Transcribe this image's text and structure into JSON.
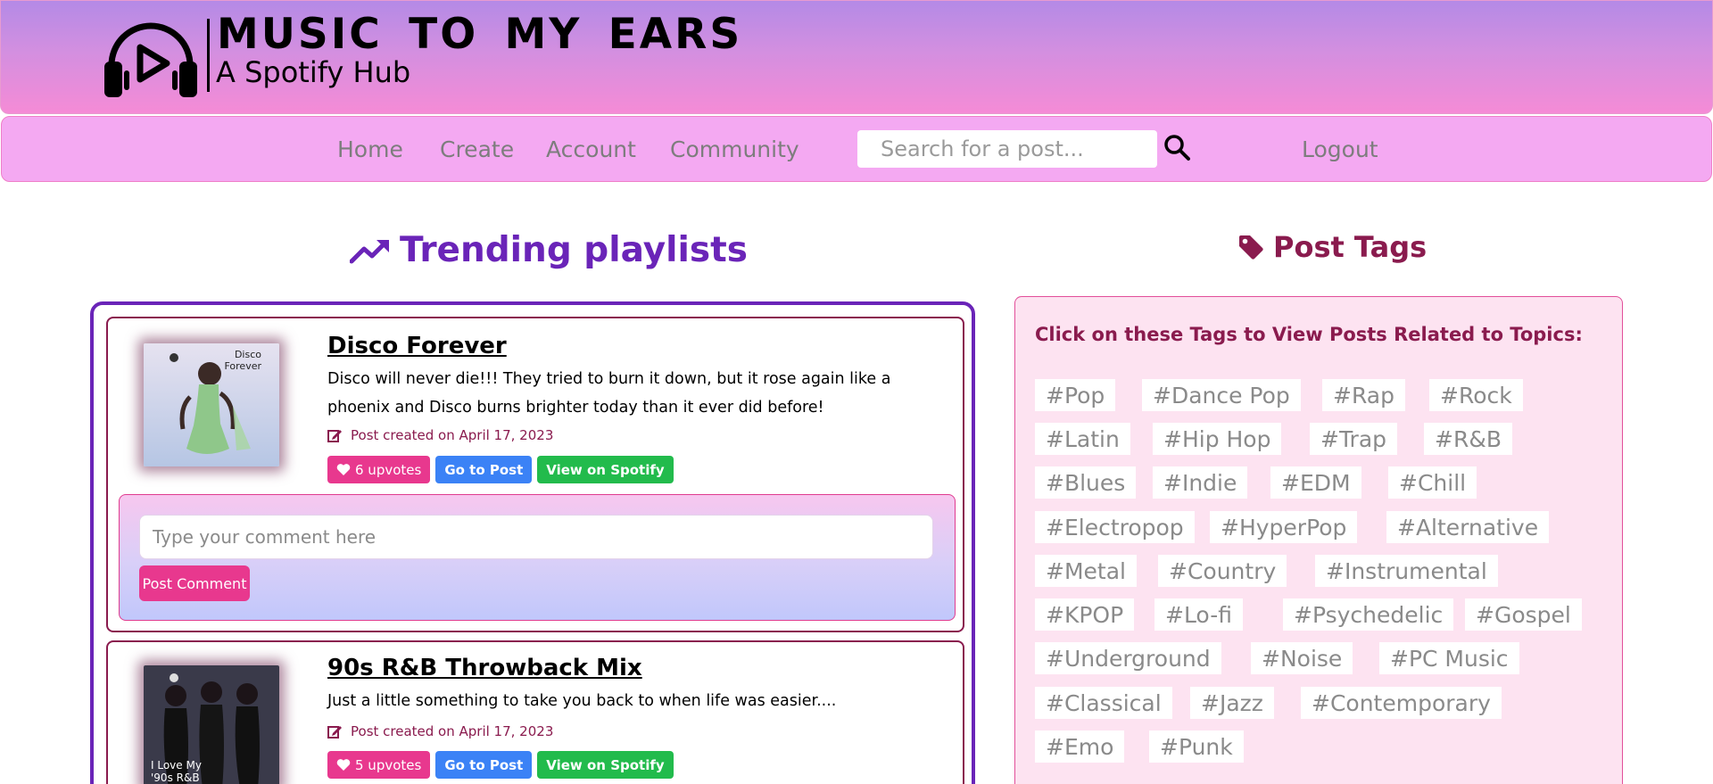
{
  "header": {
    "title": "MUSIC TO MY EARS",
    "subtitle": "A Spotify Hub",
    "icon": "headphones-play-icon"
  },
  "nav": {
    "links": [
      "Home",
      "Create",
      "Account",
      "Community"
    ],
    "search_placeholder": "Search for a post...",
    "search_icon": "search-icon",
    "logout": "Logout"
  },
  "trending": {
    "title": "Trending playlists",
    "icon": "trending-up-icon",
    "posts": [
      {
        "title": "Disco Forever",
        "cover_text": "Disco Forever",
        "description": "Disco will never die!!! They tried to burn it down, but it rose again like a phoenix and Disco burns brighter today than it ever did before!",
        "date": "Post created on April 17, 2023",
        "upvotes": "6 upvotes",
        "goto_label": "Go to Post",
        "spotify_label": "View on Spotify"
      },
      {
        "title": "90s R&B Throwback Mix",
        "cover_text": "I Love My '90s R&B",
        "description": "Just a little something to take you back to when life was easier....",
        "date": "Post created on April 17, 2023",
        "upvotes": "5 upvotes",
        "goto_label": "Go to Post",
        "spotify_label": "View on Spotify"
      }
    ],
    "comment": {
      "placeholder": "Type your comment here",
      "button": "Post Comment"
    }
  },
  "tags": {
    "title": "Post Tags",
    "icon": "tag-icon",
    "heading": "Click on these Tags to View Posts Related to Topics:",
    "items": [
      "#Pop",
      "#Dance Pop",
      "#Rap",
      "#Rock",
      "#Latin",
      "#Hip Hop",
      "#Trap",
      "#R&B",
      "#Blues",
      "#Indie",
      "#EDM",
      "#Chill",
      "#Electropop",
      "#HyperPop",
      "#Alternative",
      "#Metal",
      "#Country",
      "#Instrumental",
      "#KPOP",
      "#Lo-fi",
      "#Psychedelic",
      "#Gospel",
      "#Underground",
      "#Noise",
      "#PC Music",
      "#Classical",
      "#Jazz",
      "#Contemporary",
      "#Emo",
      "#Punk"
    ]
  },
  "colors": {
    "brand_purple": "#6a24b8",
    "brand_maroon": "#8a1b4e",
    "upvote_pink": "#e8388e",
    "goto_blue": "#3b82f6",
    "spotify_green": "#22bb4c"
  }
}
